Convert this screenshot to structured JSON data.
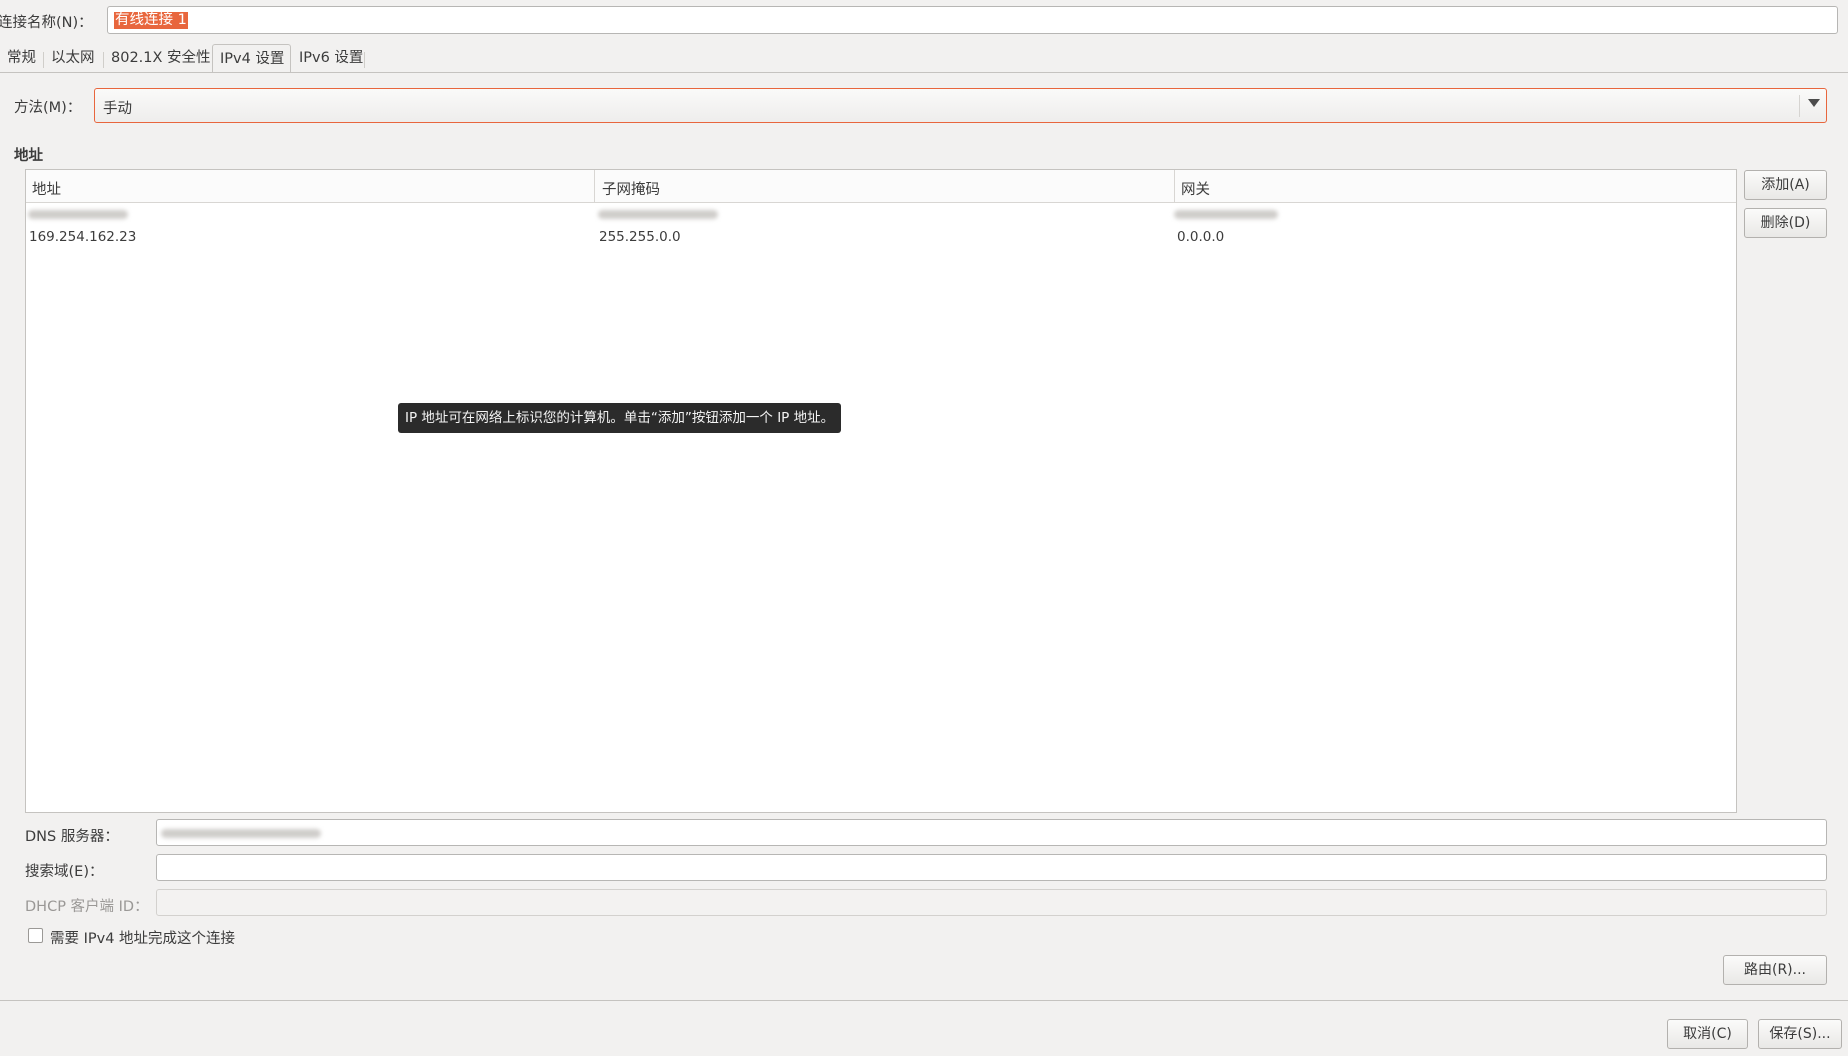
{
  "connection": {
    "label": "连接名称(N)：",
    "value": "有线连接 1"
  },
  "tabs": [
    {
      "label": "常规",
      "active": false
    },
    {
      "label": "以太网",
      "active": false
    },
    {
      "label": "802.1X 安全性",
      "active": false
    },
    {
      "label": "IPv4 设置",
      "active": true
    },
    {
      "label": "IPv6 设置",
      "active": false
    }
  ],
  "method": {
    "label": "方法(M)：",
    "value": "手动"
  },
  "address": {
    "heading": "地址",
    "columns": [
      "地址",
      "子网掩码",
      "网关"
    ],
    "rows": [
      {
        "address": "169.254.162.23",
        "netmask": "255.255.0.0",
        "gateway": "0.0.0.0"
      }
    ],
    "tooltip": "IP 地址可在网络上标识您的计算机。单击“添加”按钮添加一个 IP 地址。",
    "add_label": "添加(A)",
    "delete_label": "删除(D)"
  },
  "fields": {
    "dns_label": "DNS 服务器：",
    "search_label": "搜索域(E)：",
    "dhcp_label": "DHCP 客户端 ID："
  },
  "require": {
    "label": "需要 IPv4 地址完成这个连接",
    "checked": false
  },
  "routes_label": "路由(R)...",
  "cancel_label": "取消(C)",
  "save_label": "保存(S)...",
  "colors": {
    "accent": "#e8663d",
    "tooltip_bg": "#2b2b2b",
    "window_bg": "#f2f1f0"
  }
}
